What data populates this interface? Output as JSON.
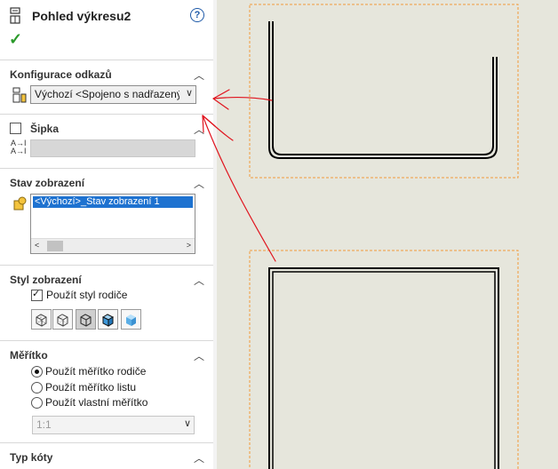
{
  "panel": {
    "title": "Pohled výkresu2",
    "help_icon": "?",
    "ok_icon": "✓",
    "sections": {
      "reference_config": {
        "heading": "Konfigurace odkazů",
        "combo_value": "Výchozí <Spojeno s nadřazeným"
      },
      "arrow": {
        "label": "Šipka",
        "checked": false,
        "text_value": ""
      },
      "display_state": {
        "heading": "Stav zobrazení",
        "items": [
          "<Výchozí>_Stav zobrazení 1"
        ]
      },
      "display_style": {
        "heading": "Styl zobrazení",
        "use_parent_style": "Použít styl rodiče",
        "use_parent_checked": true,
        "modes": [
          "wireframe-icon",
          "hidden-lines-visible-icon",
          "hidden-lines-removed-icon",
          "shaded-with-edges-icon",
          "shaded-icon"
        ],
        "active_mode": 2
      },
      "scale": {
        "heading": "Měřítko",
        "options": [
          "Použít měřítko rodiče",
          "Použít měřítko listu",
          "Použít vlastní měřítko"
        ],
        "selected": 0,
        "custom_value": "1:1"
      },
      "dimension_type": {
        "heading": "Typ kóty"
      }
    }
  },
  "colors": {
    "canvas": "#e6e6dc",
    "annotation": "#e0141e",
    "selection": "#1e72d0",
    "view_border": "#f29a3a"
  }
}
